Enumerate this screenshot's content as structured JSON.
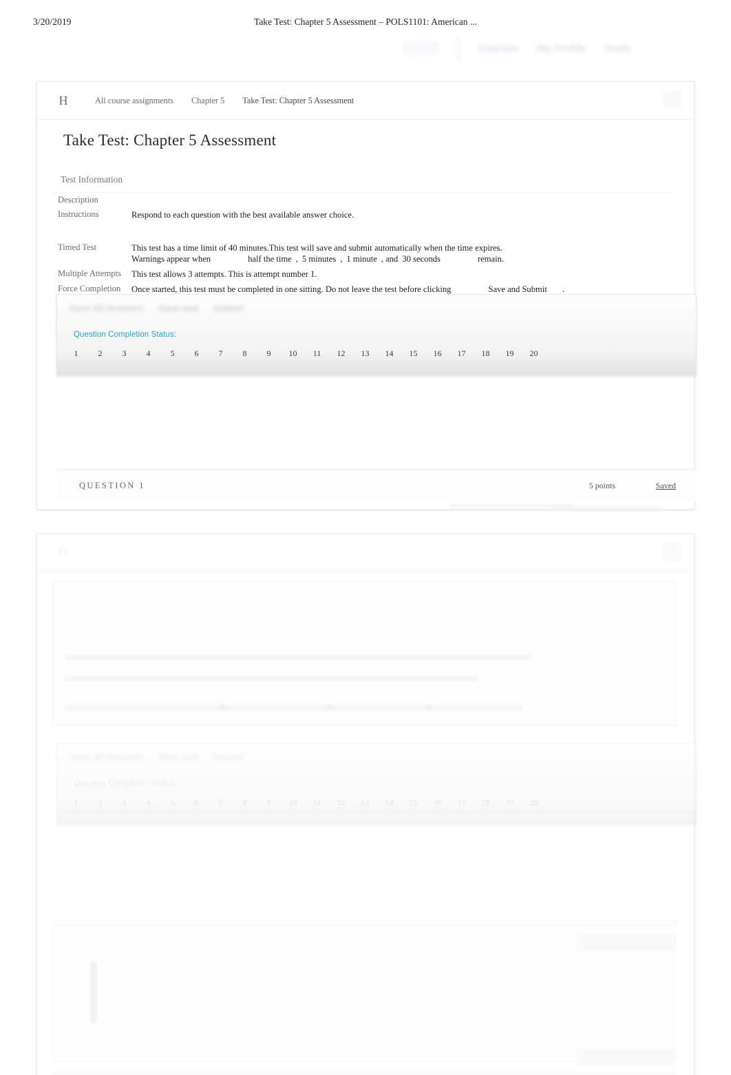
{
  "print": {
    "date": "3/20/2019",
    "title": "Take Test: Chapter 5 Assessment – POLS1101: American ..."
  },
  "site_nav": {
    "items": [
      {
        "label": "Courses"
      },
      {
        "label": "My Profile"
      },
      {
        "label": "Tools"
      }
    ]
  },
  "breadcrumb": {
    "logo": "H",
    "items": [
      {
        "label": "All course assignments"
      },
      {
        "label": "Chapter 5"
      },
      {
        "label": "Take Test: Chapter 5 Assessment"
      }
    ]
  },
  "page": {
    "title": "Take Test: Chapter 5 Assessment"
  },
  "test_information": {
    "heading": "Test Information",
    "rows": [
      {
        "label": "Description",
        "value": ""
      },
      {
        "label": "Instructions",
        "value": "Respond to each question with the best available answer choice."
      },
      {
        "label": "Timed Test",
        "line1": "This test has a time limit of 40 minutes.This test will save and submit automatically when the time expires.",
        "warn_prefix": "Warnings appear when",
        "warn_1": "half the time",
        "warn_sep_1": ",",
        "warn_2": "5 minutes",
        "warn_sep_2": ",",
        "warn_3": "1 minute",
        "warn_sep_3": ", and",
        "warn_4": "30 seconds",
        "warn_suffix": "remain."
      },
      {
        "label": "Multiple Attempts",
        "value": "This test allows 3 attempts. This is attempt number 1."
      },
      {
        "label": "Force Completion",
        "prefix": "Once started, this test must be completed in one sitting. Do not leave the test before clicking",
        "button": "Save and Submit",
        "suffix": "."
      }
    ]
  },
  "action_bar": {
    "buttons": [
      {
        "label": "Save All Answers"
      },
      {
        "label": "Save and"
      },
      {
        "label": "Submit"
      }
    ],
    "completion_status_label": "Question Completion Status:",
    "question_numbers": [
      "1",
      "2",
      "3",
      "4",
      "5",
      "6",
      "7",
      "8",
      "9",
      "10",
      "11",
      "12",
      "13",
      "14",
      "15",
      "16",
      "17",
      "18",
      "19",
      "20"
    ]
  },
  "question": {
    "label": "QUESTION 1",
    "points": "5 points",
    "status": "Saved"
  },
  "colors": {
    "link_teal": "#2e9fbb",
    "text_body": "#1d1c1a",
    "text_muted": "#6d6a64",
    "sheet_bg": "#ffffff"
  }
}
